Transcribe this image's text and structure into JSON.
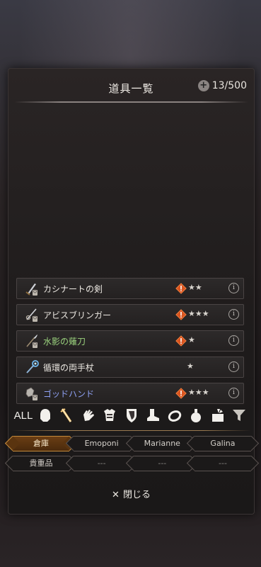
{
  "header": {
    "title": "道具一覧",
    "count": "13/500"
  },
  "items": [
    {
      "name": "カシナートの剣",
      "icon": "sword-icon",
      "warning": true,
      "stars": "★★",
      "color": "#ece8e2"
    },
    {
      "name": "アビスブリンガー",
      "icon": "rapier-icon",
      "warning": true,
      "stars": "★★★",
      "color": "#ece8e2"
    },
    {
      "name": "水影の薙刀",
      "icon": "naginata-icon",
      "warning": true,
      "stars": "★",
      "color": "#9ad27d"
    },
    {
      "name": "循環の両手杖",
      "icon": "staff-icon",
      "warning": false,
      "stars": "★",
      "color": "#ece8e2"
    },
    {
      "name": "ゴッドハンド",
      "icon": "gauntlet-icon",
      "warning": true,
      "stars": "★★★",
      "color": "#8ea0f2"
    }
  ],
  "categories": {
    "all_label": "ALL",
    "icons": [
      "head-icon",
      "weapon-icon",
      "hand-icon",
      "armor-icon",
      "shield-icon",
      "boot-icon",
      "ring-icon",
      "potion-icon",
      "box-icon",
      "filter-icon"
    ],
    "selected": "weapon-icon"
  },
  "tabs": {
    "row1": [
      "倉庫",
      "Emoponi",
      "Marianne",
      "Galina"
    ],
    "row1_active": "倉庫",
    "row2": [
      "貴重品",
      "---",
      "---",
      "---"
    ]
  },
  "footer": {
    "close_label": "閉じる",
    "close_symbol": "✕"
  },
  "info_symbol": "i"
}
